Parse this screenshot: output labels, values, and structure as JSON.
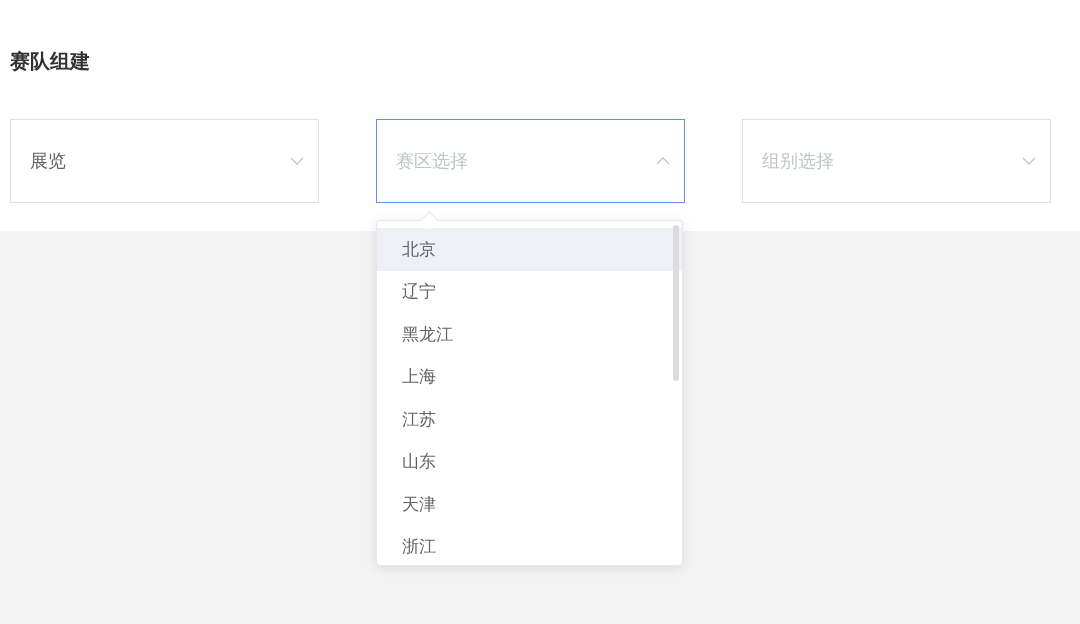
{
  "title": "赛队组建",
  "selects": [
    {
      "value": "展览",
      "expanded": false
    },
    {
      "placeholder": "赛区选择",
      "expanded": true
    },
    {
      "placeholder": "组别选择",
      "expanded": false
    }
  ],
  "dropdown": {
    "options": [
      {
        "label": "北京",
        "highlighted": true
      },
      {
        "label": "辽宁",
        "highlighted": false
      },
      {
        "label": "黑龙江",
        "highlighted": false
      },
      {
        "label": "上海",
        "highlighted": false
      },
      {
        "label": "江苏",
        "highlighted": false
      },
      {
        "label": "山东",
        "highlighted": false
      },
      {
        "label": "天津",
        "highlighted": false
      },
      {
        "label": "浙江",
        "highlighted": false
      }
    ]
  }
}
